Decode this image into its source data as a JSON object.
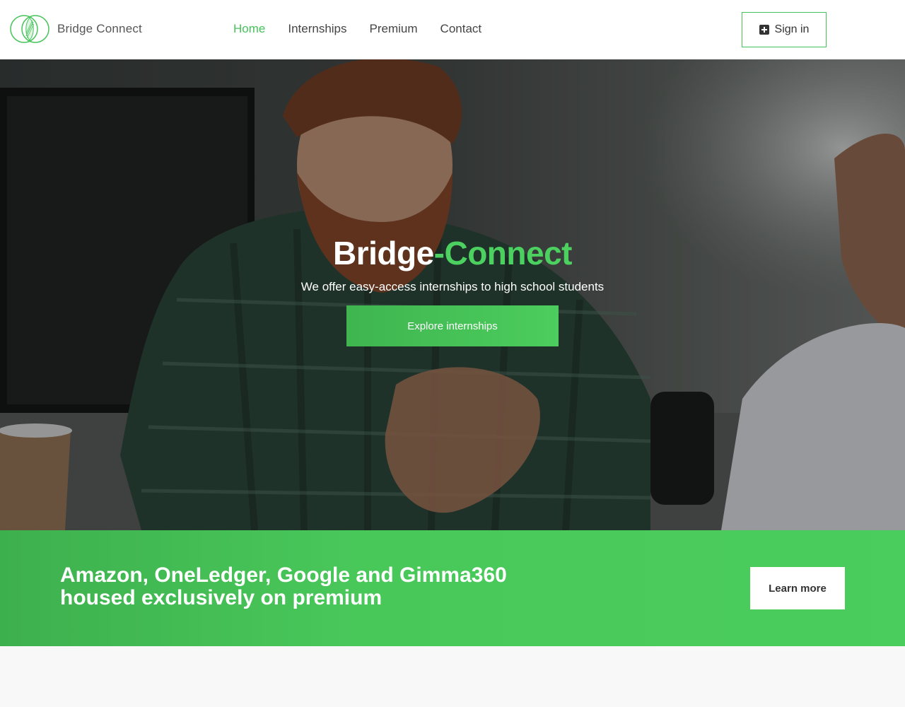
{
  "brand": {
    "name": "Bridge Connect",
    "accent_color": "#46c35a"
  },
  "nav": {
    "items": [
      {
        "label": "Home",
        "active": true
      },
      {
        "label": "Internships",
        "active": false
      },
      {
        "label": "Premium",
        "active": false
      },
      {
        "label": "Contact",
        "active": false
      }
    ],
    "signin_label": "Sign in",
    "signin_icon": "plus-square-icon"
  },
  "hero": {
    "title_main": "Bridge",
    "title_accent": "-Connect",
    "subtitle": "We offer easy-access internships to high school students",
    "cta_label": "Explore internships"
  },
  "promo": {
    "text": "Amazon, OneLedger, Google and Gimma360 housed exclusively on premium",
    "button_label": "Learn more"
  }
}
